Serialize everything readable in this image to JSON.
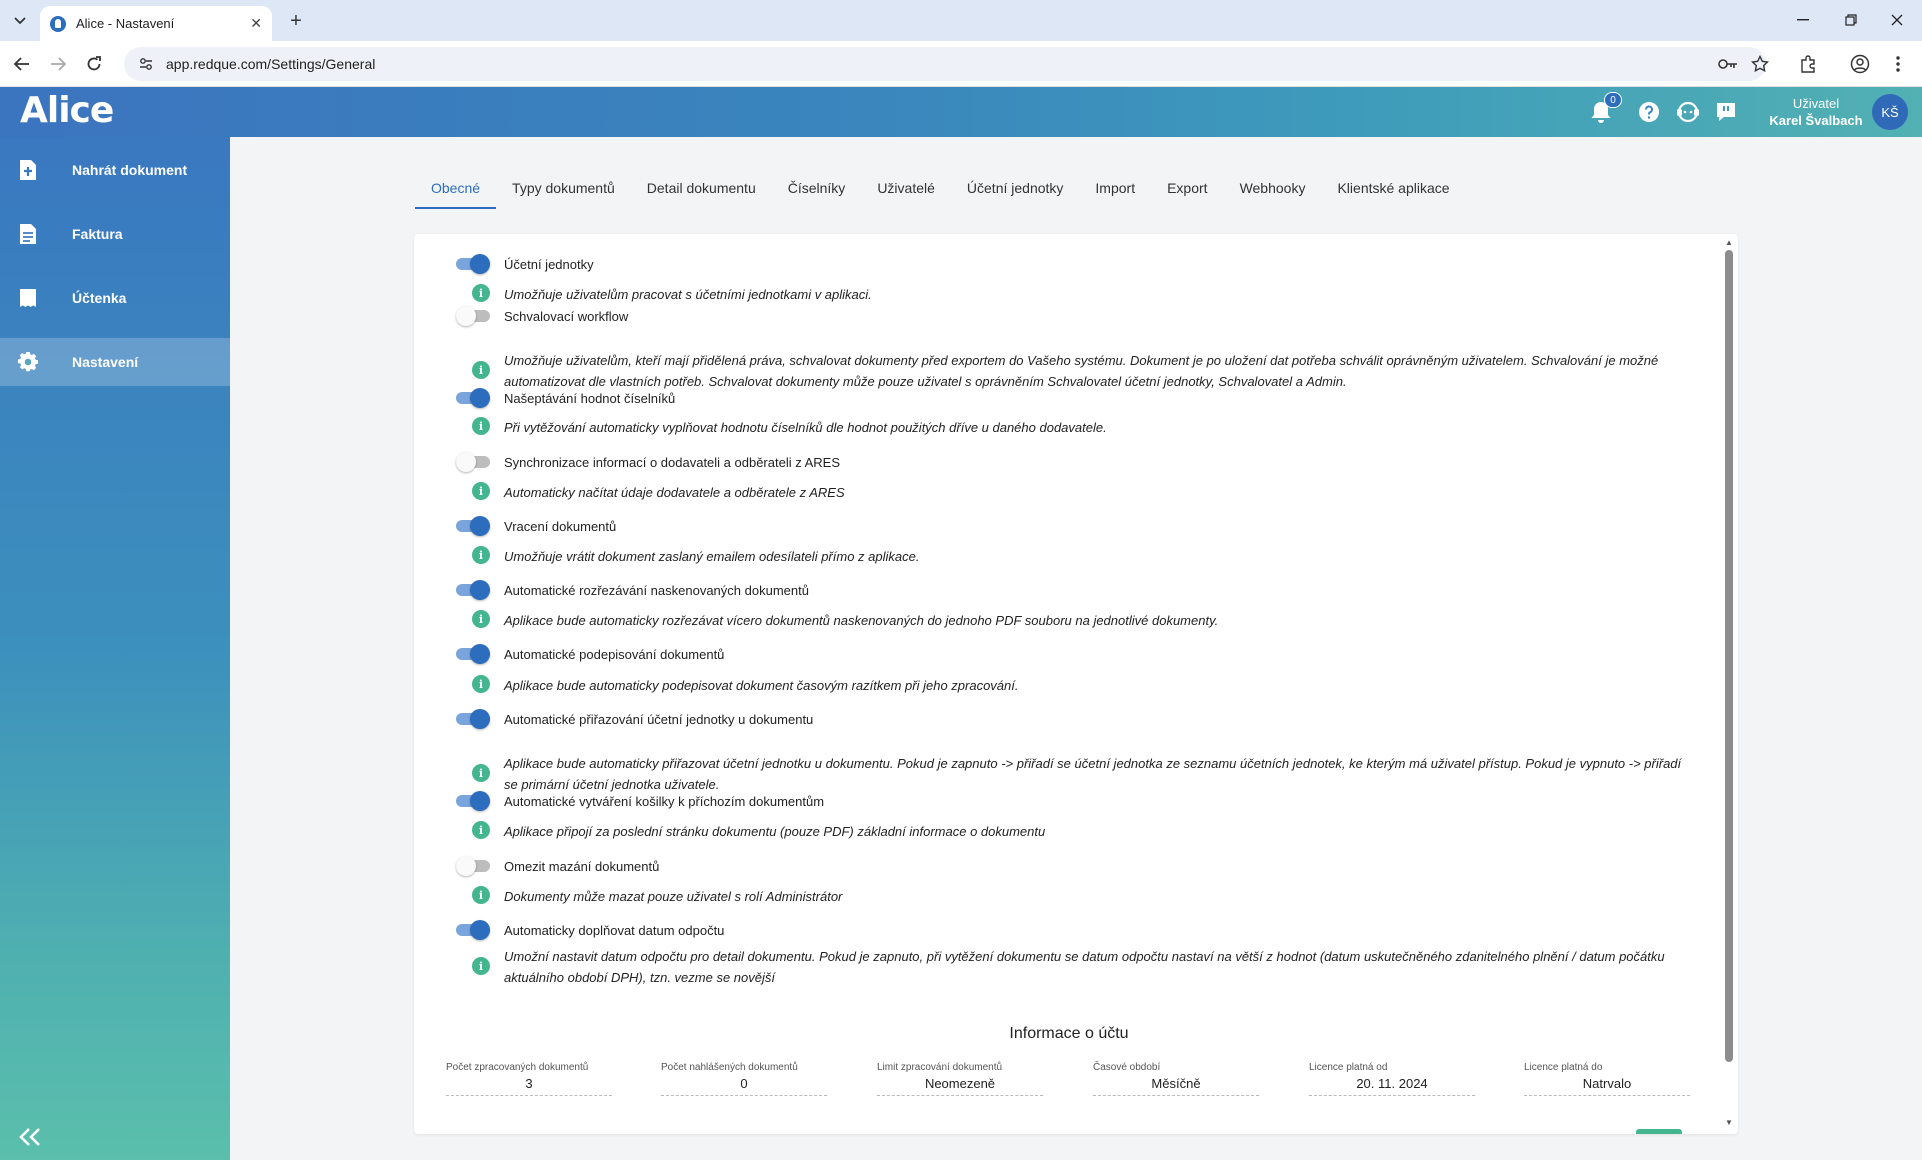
{
  "browser": {
    "tab_title": "Alice - Nastavení",
    "url": "app.redque.com/Settings/General"
  },
  "header": {
    "logo": "Alice",
    "notification_count": "0",
    "user_label": "Uživatel",
    "user_name": "Karel Švalbach",
    "avatar_initials": "KŠ"
  },
  "sidebar": {
    "items": [
      {
        "label": "Nahrát dokument",
        "icon": "upload-document-icon"
      },
      {
        "label": "Faktura",
        "icon": "document-icon"
      },
      {
        "label": "Účtenka",
        "icon": "receipt-icon"
      },
      {
        "label": "Nastavení",
        "icon": "gear-icon",
        "active": true
      }
    ]
  },
  "tabs": [
    {
      "label": "Obecné",
      "active": true
    },
    {
      "label": "Typy dokumentů"
    },
    {
      "label": "Detail dokumentu"
    },
    {
      "label": "Číselníky"
    },
    {
      "label": "Uživatelé"
    },
    {
      "label": "Účetní jednotky"
    },
    {
      "label": "Import"
    },
    {
      "label": "Export"
    },
    {
      "label": "Webhooky"
    },
    {
      "label": "Klientské aplikace"
    }
  ],
  "settings": [
    {
      "label": "Účetní jednotky",
      "enabled": true,
      "description": "Umožňuje uživatelům pracovat s účetními jednotkami v aplikaci."
    },
    {
      "label": "Schvalovací workflow",
      "enabled": false,
      "description": "Umožňuje uživatelům, kteří mají přidělená práva, schvalovat dokumenty před exportem do Vašeho systému. Dokument je po uložení dat potřeba schválit oprávněným uživatelem. Schvalování je možné automatizovat dle vlastních potřeb. Schvalovat dokumenty může pouze uživatel s oprávněním Schvalovatel účetní jednotky, Schvalovatel a Admin."
    },
    {
      "label": "Našeptávání hodnot číselníků",
      "enabled": true,
      "description": "Při vytěžování automaticky vyplňovat hodnotu číselníků dle hodnot použitých dříve u daného dodavatele."
    },
    {
      "label": "Synchronizace informací o dodavateli a odběrateli z ARES",
      "enabled": false,
      "description": "Automaticky načítat údaje dodavatele a odběratele z ARES"
    },
    {
      "label": "Vracení dokumentů",
      "enabled": true,
      "description": "Umožňuje vrátit dokument zaslaný emailem odesílateli přímo z aplikace."
    },
    {
      "label": "Automatické rozřezávání naskenovaných dokumentů",
      "enabled": true,
      "description": "Aplikace bude automaticky rozřezávat vícero dokumentů naskenovaných do jednoho PDF souboru na jednotlivé dokumenty."
    },
    {
      "label": "Automatické podepisování dokumentů",
      "enabled": true,
      "description": "Aplikace bude automaticky podepisovat dokument časovým razítkem při jeho zpracování."
    },
    {
      "label": "Automatické přiřazování účetní jednotky u dokumentu",
      "enabled": true,
      "description": "Aplikace bude automaticky přiřazovat účetní jednotku u dokumentu. Pokud je zapnuto -> přiřadí se účetní jednotka ze seznamu účetních jednotek, ke kterým má uživatel přístup. Pokud je vypnuto -> přiřadí se primární účetní jednotka uživatele."
    },
    {
      "label": "Automatické vytváření košilky k příchozím dokumentům",
      "enabled": true,
      "description": "Aplikace připojí za poslední stránku dokumentu (pouze PDF) základní informace o dokumentu"
    },
    {
      "label": "Omezit mazání dokumentů",
      "enabled": false,
      "description": "Dokumenty může mazat pouze uživatel s rolí Administrátor"
    },
    {
      "label": "Automaticky doplňovat datum odpočtu",
      "enabled": true,
      "description": "Umožní nastavit datum odpočtu pro detail dokumentu. Pokud je zapnuto, při vytěžení dokumentu se datum odpočtu nastaví na větší z hodnot (datum uskutečněného zdanitelného plnění / datum počátku aktuálního období DPH), tzn. vezme se novější"
    }
  ],
  "account": {
    "title": "Informace o účtu",
    "stats": [
      {
        "label": "Počet zpracovaných dokumentů",
        "value": "3"
      },
      {
        "label": "Počet nahlášených dokumentů",
        "value": "0"
      },
      {
        "label": "Limit zpracování dokumentů",
        "value": "Neomezeně"
      },
      {
        "label": "Časové období",
        "value": "Měsíčně"
      },
      {
        "label": "Licence platná od",
        "value": "20. 11. 2024"
      },
      {
        "label": "Licence platná do",
        "value": "Natrvalo"
      }
    ]
  },
  "colors": {
    "primary": "#2c6dbd",
    "info_green": "#44b68f",
    "toggle_track_on": "#7aa5dc",
    "toggle_track_off": "#bdbdbd"
  }
}
